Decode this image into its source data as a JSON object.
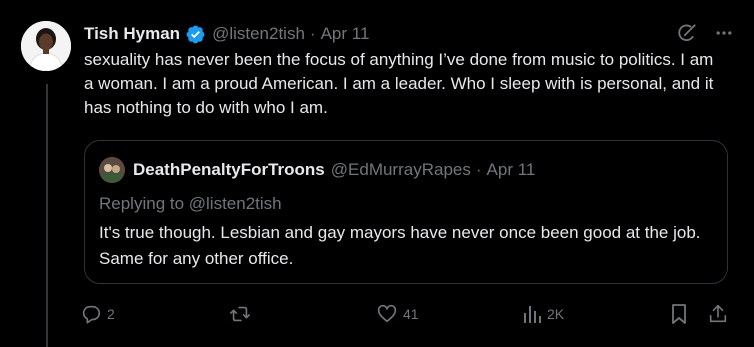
{
  "tweet": {
    "author_name": "Tish Hyman",
    "handle": "@listen2tish",
    "separator": "·",
    "date": "Apr 11",
    "text": "sexuality has never been the focus of anything I’ve done from music to politics. I am a woman. I am a proud American. I am a leader. Who I sleep with is personal, and it has nothing to do with who I am."
  },
  "quote": {
    "author_name": "DeathPenaltyForTroons",
    "handle": "@EdMurrayRapes",
    "separator": "·",
    "date": "Apr 11",
    "replying_to": "Replying to @listen2tish",
    "text": "It's true though. Lesbian and gay mayors have never once been good at the job. Same for any other office."
  },
  "actions": {
    "replies": "2",
    "retweets": "",
    "likes": "41",
    "views": "2K"
  },
  "colors": {
    "background": "#000000",
    "text": "#e7e9ea",
    "secondary": "#71767b",
    "border": "#2f3336",
    "verified": "#1d9bf0"
  },
  "icons": [
    "verified-badge-icon",
    "grok-icon",
    "more-icon",
    "reply-icon",
    "retweet-icon",
    "like-icon",
    "views-icon",
    "bookmark-icon",
    "share-icon"
  ]
}
